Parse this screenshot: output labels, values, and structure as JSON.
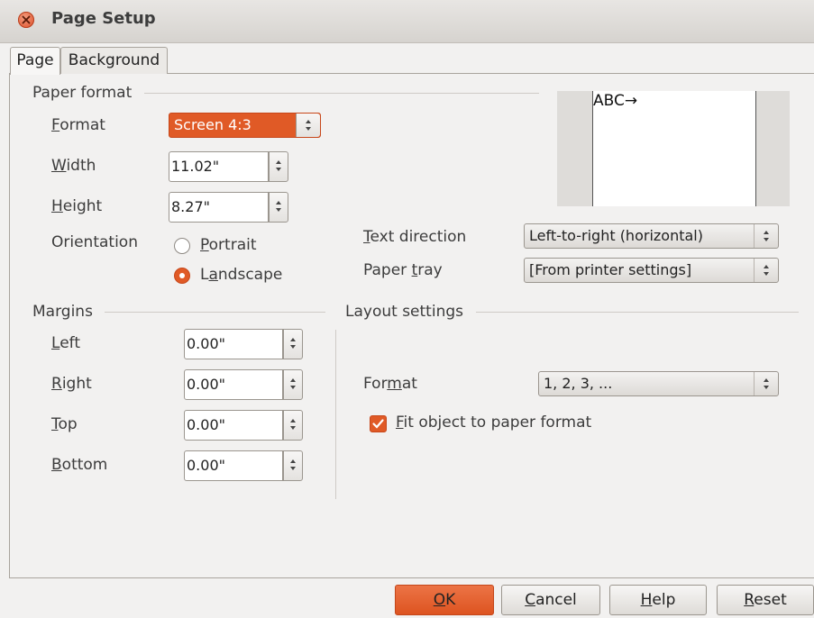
{
  "window": {
    "title": "Page Setup"
  },
  "tabs": [
    {
      "label": "Page"
    },
    {
      "label": "Background"
    }
  ],
  "paper_format": {
    "group_title": "Paper format",
    "format_label_key": "F",
    "format_label_rest": "ormat",
    "format_value": "Screen 4:3",
    "width_label_key": "W",
    "width_label_rest": "idth",
    "width_value": "11.02\"",
    "height_label_key": "H",
    "height_label_rest": "eight",
    "height_value": "8.27\"",
    "orientation_label": "Orientation",
    "portrait_key": "P",
    "portrait_rest": "ortrait",
    "landscape_pre": "L",
    "landscape_key": "a",
    "landscape_rest": "ndscape",
    "orientation_selected": "Landscape",
    "text_direction_label_key": "T",
    "text_direction_label_rest": "ext direction",
    "text_direction_value": "Left-to-right (horizontal)",
    "paper_tray_label_pre": "Paper ",
    "paper_tray_label_key": "t",
    "paper_tray_label_rest": "ray",
    "paper_tray_value": "[From printer settings]",
    "preview_text": "ABC→"
  },
  "margins": {
    "group_title": "Margins",
    "left_key": "L",
    "left_rest": "eft",
    "left_value": "0.00\"",
    "right_key": "R",
    "right_rest": "ight",
    "right_value": "0.00\"",
    "top_key": "T",
    "top_rest": "op",
    "top_value": "0.00\"",
    "bottom_key": "B",
    "bottom_rest": "ottom",
    "bottom_value": "0.00\""
  },
  "layout_settings": {
    "group_title": "Layout settings",
    "format_label_pre": "For",
    "format_label_key": "m",
    "format_label_rest": "at",
    "format_value": "1, 2, 3, ...",
    "fit_key": "F",
    "fit_rest": "it object to paper format",
    "fit_checked": true
  },
  "buttons": {
    "ok_key": "O",
    "ok_rest": "K",
    "cancel_key": "C",
    "cancel_rest": "ancel",
    "help_key": "H",
    "help_rest": "elp",
    "reset_key": "R",
    "reset_rest": "eset"
  },
  "colors": {
    "accent": "#e05a26",
    "background": "#f2f1f0",
    "close": "#dc4d27"
  },
  "icons": [
    "close-icon",
    "spin-arrows-icon",
    "combo-arrows-icon",
    "checkmark-icon",
    "radio-dot-icon"
  ]
}
